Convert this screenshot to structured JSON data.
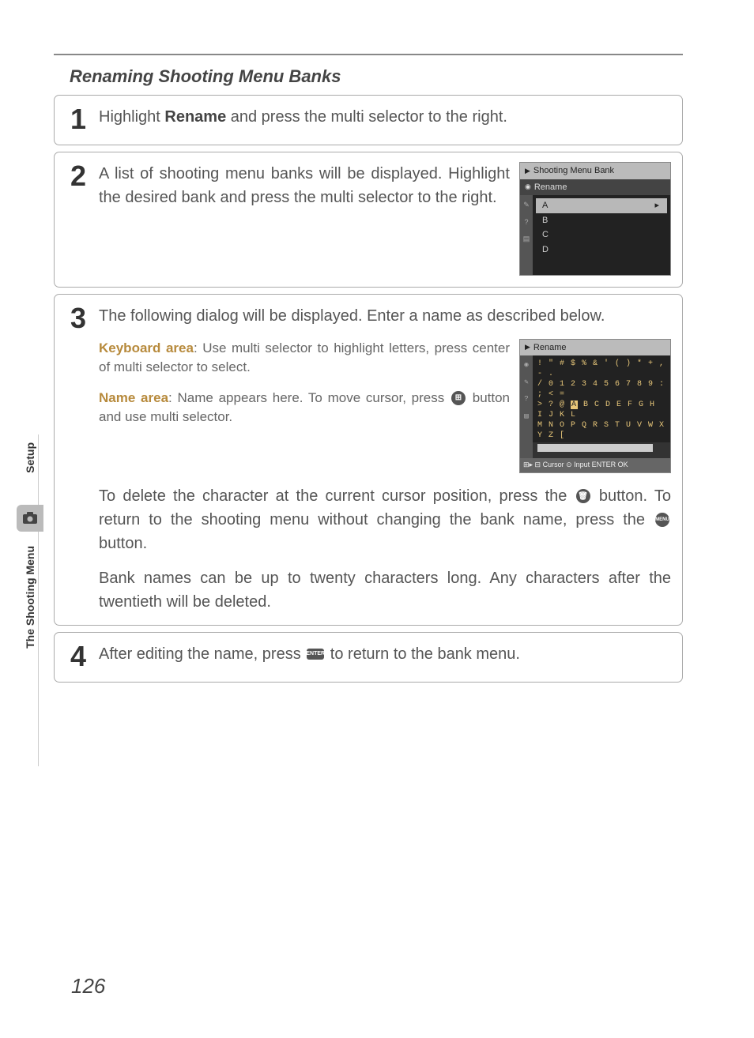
{
  "section_title": "Renaming Shooting Menu Banks",
  "page_number": "126",
  "side_rail": {
    "label1": "Setup",
    "label2": "The Shooting Menu"
  },
  "steps": {
    "s1": {
      "num": "1",
      "text_a": "Highlight ",
      "text_bold": "Rename",
      "text_b": " and press the multi selector to the right."
    },
    "s2": {
      "num": "2",
      "text": "A list of shooting menu banks will be displayed.  Highlight the desired bank and press the multi selector to the right."
    },
    "s3": {
      "num": "3",
      "lead": "The following dialog will be displayed.  Enter a name as described below.",
      "kb_label": "Keyboard area",
      "kb_text": ": Use multi selector to highlight letters, press center of multi selector to select.",
      "na_label": "Name area",
      "na_text_a": ": Name appears here.  To move cursor, press ",
      "na_text_b": " button and use multi selector.",
      "del_a": "To delete the character at the current cursor position, press the ",
      "del_b": " button.  To return to the shooting menu without changing the bank name, press the ",
      "del_c": " button.",
      "limit": "Bank names can be up to twenty characters long.  Any characters after the twentieth will be deleted."
    },
    "s4": {
      "num": "4",
      "text_a": "After editing the name, press ",
      "text_b": " to return to the bank menu."
    }
  },
  "cam1": {
    "title": "Shooting Menu Bank",
    "subtitle": "Rename",
    "rows": {
      "a": "A",
      "b": "B",
      "c": "C",
      "d": "D"
    },
    "arrow": "▸"
  },
  "cam2": {
    "title": "Rename",
    "row1": "! \" # $ % & ' ( ) * + , - .",
    "row2": "/ 0 1 2 3 4 5 6 7 8 9 : ; < =",
    "row3_a": "> ? @ ",
    "row3_hl": "A",
    "row3_b": " B C D E F G H I J K L",
    "row4": "M N O P Q R S T U V W X Y Z [",
    "hint_full": "⊞▸ ⊟ Cursor ⊙ Input  ENTER  OK"
  },
  "icons": {
    "grid": "⊞",
    "trash": "🗑",
    "menu": "MENU",
    "enter": "ENTER"
  }
}
